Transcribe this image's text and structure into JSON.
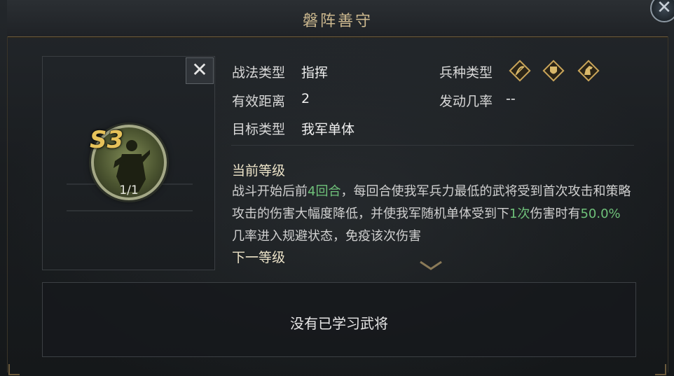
{
  "header": {
    "title": "磐阵善守"
  },
  "skill": {
    "grade": "S3",
    "count": "1/1"
  },
  "info": {
    "type_label": "战法类型",
    "type_value": "指挥",
    "range_label": "有效距离",
    "range_value": "2",
    "target_label": "目标类型",
    "target_value": "我军单体",
    "troop_label": "兵种类型",
    "troop_icons": [
      "bow-icon",
      "shield-icon",
      "horse-icon"
    ],
    "chance_label": "发动几率",
    "chance_value": "--"
  },
  "current_level": {
    "title": "当前等级",
    "desc_parts": [
      "战斗开始后前",
      "4回合",
      "，每回合使我军兵力最低的武将受到首次攻击和策略攻击的伤害大幅度降低，并使我军随机单体受到下",
      "1次",
      "伤害时有",
      "50.0%",
      "几率进入规避状态，免疫该次伤害"
    ]
  },
  "next_level": {
    "title": "下一等级"
  },
  "generals": {
    "empty_text": "没有已学习武将"
  },
  "colors": {
    "accent": "#cdb98f",
    "highlight": "#6fc17a",
    "grade": "#e6c25a"
  }
}
